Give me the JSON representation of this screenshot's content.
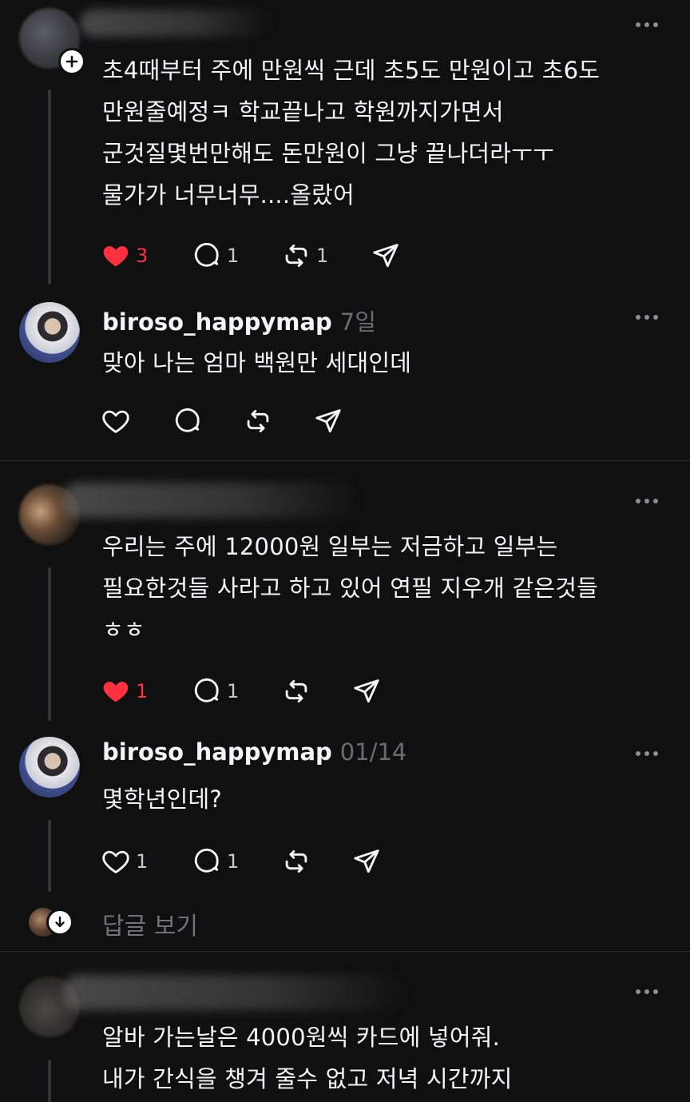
{
  "comments": [
    {
      "author": "",
      "author_blurred": true,
      "timestamp": "",
      "text": "초4때부터 주에 만원씩 근데 초5도 만원이고 초6도\n만원줄예정ㅋ 학교끝나고 학원까지가면서\n군것질몇번만해도 돈만원이 그냥 끝나더라ㅜㅜ\n물가가 너무너무....올랐어",
      "likes": "3",
      "liked": true,
      "replies": "1",
      "reposts": "1"
    },
    {
      "author": "biroso_happymap",
      "timestamp": "7일",
      "text": "맞아 나는 엄마 백원만 세대인데",
      "likes": "",
      "replies": "",
      "reposts": ""
    },
    {
      "author": "",
      "author_blurred": true,
      "timestamp": "",
      "text": "우리는 주에 12000원  일부는 저금하고 일부는\n필요한것들 사라고 하고 있어 연필 지우개 같은것들\nㅎㅎ",
      "likes": "1",
      "liked": true,
      "replies": "1",
      "reposts": ""
    },
    {
      "author": "biroso_happymap",
      "timestamp": "01/14",
      "text": "몇학년인데?",
      "likes": "1",
      "replies": "1",
      "reposts": ""
    },
    {
      "author": "",
      "author_blurred": true,
      "timestamp": "",
      "text": "알바 가는날은 4000원씩 카드에 넣어줘.\n내가 간식을 챙겨 줄수 없고 저녁 시간까지"
    }
  ],
  "view_replies_label": "답글 보기",
  "icons": {
    "more": "more-options-icon",
    "heart": "heart-icon",
    "comment": "comment-icon",
    "repost": "repost-icon",
    "share": "share-icon",
    "follow": "plus-icon",
    "expand": "arrow-down-icon"
  },
  "colors": {
    "background": "#101010",
    "text": "#f3f5f7",
    "muted": "#6a6d70",
    "like_active": "#ff3040"
  }
}
